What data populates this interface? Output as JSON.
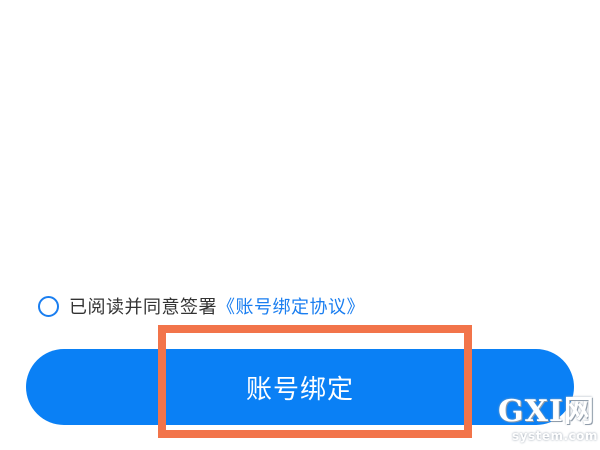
{
  "agreement": {
    "checked": false,
    "text": "已阅读并同意签署",
    "link_text": "《账号绑定协议》"
  },
  "bind_button": {
    "label": "账号绑定"
  },
  "watermark": {
    "main": "GXI网",
    "sub": "system.com"
  },
  "colors": {
    "accent": "#0a80f5",
    "link": "#1a7ef0",
    "highlight": "#f2744a",
    "text": "#333333",
    "background": "#ffffff"
  }
}
